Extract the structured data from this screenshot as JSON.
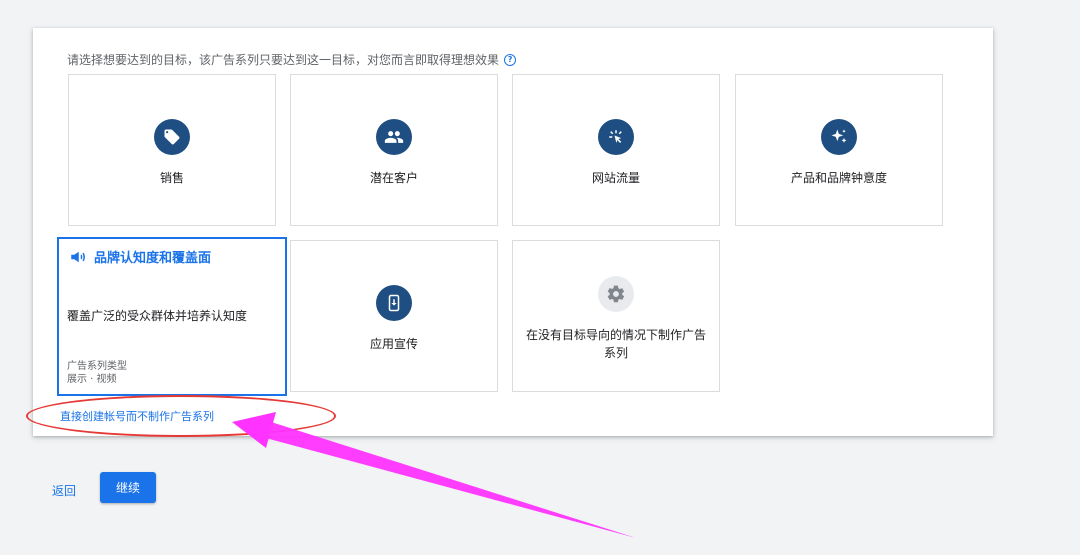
{
  "prompt": "请选择想要达到的目标，该广告系列只要达到这一目标，对您而言即取得理想效果",
  "help_icon": "?",
  "goals": [
    {
      "label": "销售",
      "icon": "tag-icon"
    },
    {
      "label": "潜在客户",
      "icon": "people-icon"
    },
    {
      "label": "网站流量",
      "icon": "cursor-click-icon"
    },
    {
      "label": "产品和品牌钟意度",
      "icon": "sparkle-icon"
    },
    {
      "label": "品牌认知度和覆盖面",
      "icon": "megaphone-icon",
      "selected": true,
      "description": "覆盖广泛的受众群体并培养认知度",
      "type_label": "广告系列类型",
      "type_value": "展示 · 视频"
    },
    {
      "label": "应用宣传",
      "icon": "phone-download-icon"
    },
    {
      "label": "在没有目标导向的情况下制作广告系列",
      "icon": "gear-icon"
    }
  ],
  "direct_link": "直接创建帐号而不制作广告系列",
  "back_label": "返回",
  "continue_label": "继续",
  "colors": {
    "accent": "#1a73e8",
    "icon_bg": "#1f4f82",
    "annotation_red": "#e53935",
    "annotation_magenta": "#ff33ff"
  }
}
